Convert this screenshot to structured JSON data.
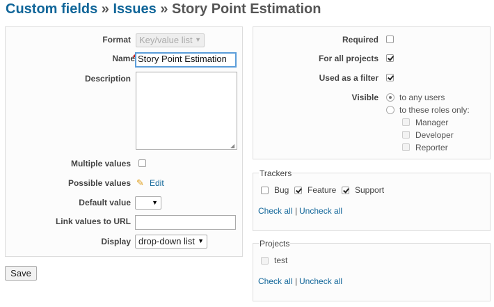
{
  "breadcrumb": {
    "crumb1": "Custom fields",
    "sep1": " » ",
    "crumb2": "Issues",
    "sep2": " » ",
    "current": "Story Point Estimation"
  },
  "left_form": {
    "format_label": "Format",
    "format_value": "Key/value list",
    "name_label": "Name",
    "required_marker": "*",
    "name_value": "Story Point Estimation",
    "description_label": "Description",
    "description_value": "",
    "multiple_values_label": "Multiple values",
    "possible_values_label": "Possible values",
    "edit_link": "Edit",
    "default_value_label": "Default value",
    "default_value": "",
    "link_values_label": "Link values to URL",
    "link_values_value": "",
    "display_label": "Display",
    "display_value": "drop-down list"
  },
  "right_form": {
    "required_label": "Required",
    "for_all_projects_label": "For all projects",
    "used_as_filter_label": "Used as a filter",
    "visible_label": "Visible",
    "visible_any": "to any users",
    "visible_roles": "to these roles only:",
    "roles": [
      "Manager",
      "Developer",
      "Reporter"
    ]
  },
  "trackers": {
    "legend": "Trackers",
    "items": [
      "Bug",
      "Feature",
      "Support"
    ],
    "check_all": "Check all",
    "separator": "|",
    "uncheck_all": "Uncheck all"
  },
  "projects": {
    "legend": "Projects",
    "items": [
      "test"
    ],
    "check_all": "Check all",
    "separator": "|",
    "uncheck_all": "Uncheck all"
  },
  "save_button": "Save"
}
